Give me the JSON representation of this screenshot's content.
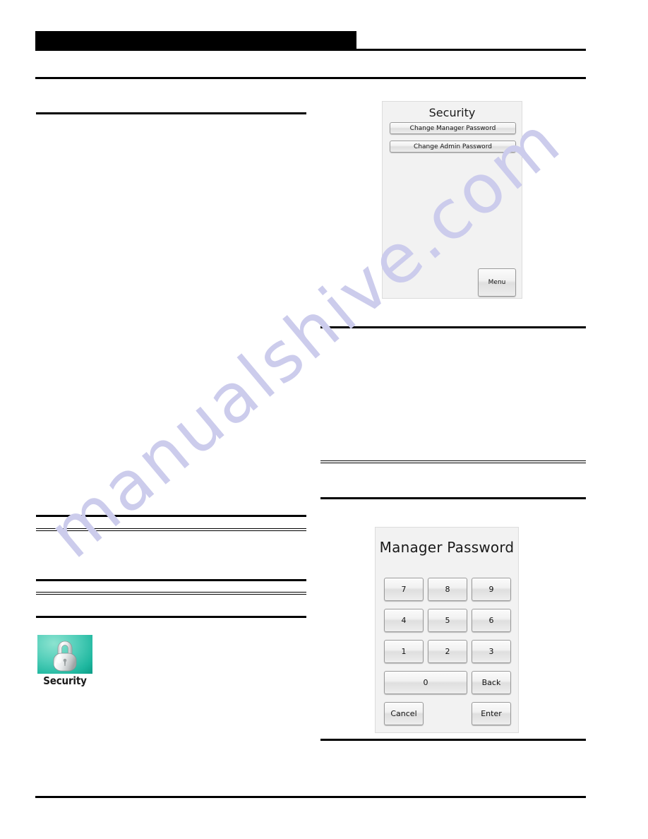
{
  "page": {
    "header_title": "",
    "watermark_text": "manualshive.com",
    "watermark_color": "#ccccec"
  },
  "security_screen": {
    "title": "Security",
    "buttons": [
      {
        "label": "Change Manager Password",
        "name": "change-manager-password-button"
      },
      {
        "label": "Change Admin Password",
        "name": "change-admin-password-button"
      }
    ],
    "menu_label": "Menu"
  },
  "keypad_screen": {
    "title": "Manager Password",
    "keys": [
      {
        "label": "7"
      },
      {
        "label": "8"
      },
      {
        "label": "9"
      },
      {
        "label": "4"
      },
      {
        "label": "5"
      },
      {
        "label": "6"
      },
      {
        "label": "1"
      },
      {
        "label": "2"
      },
      {
        "label": "3"
      }
    ],
    "zero_label": "0",
    "back_label": "Back",
    "cancel_label": "Cancel",
    "enter_label": "Enter"
  },
  "app_icon": {
    "label": "Security",
    "icon": "padlock-icon",
    "tile_color": "#2fc5ad"
  }
}
